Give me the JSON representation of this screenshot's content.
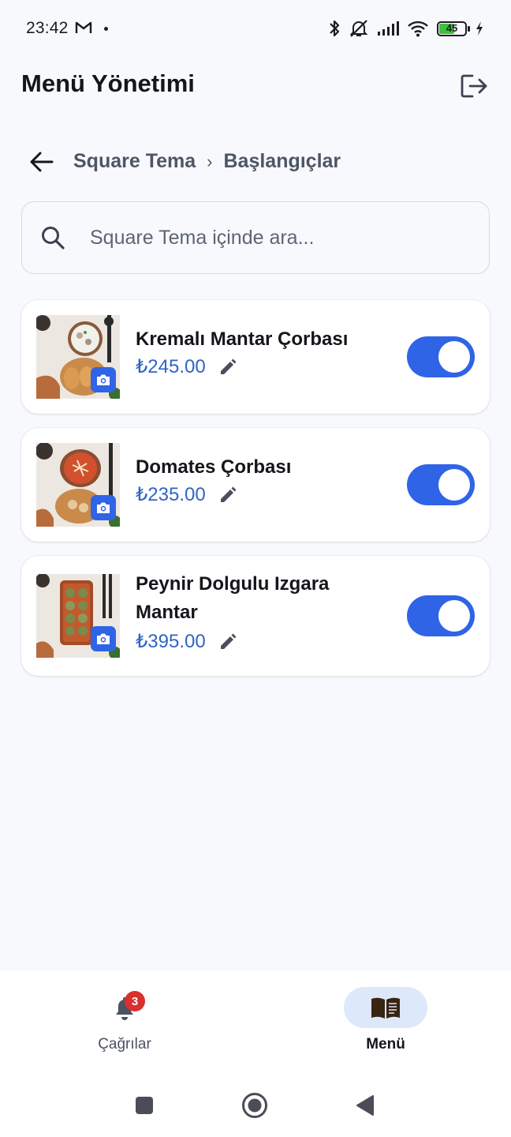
{
  "status_bar": {
    "time": "23:42",
    "battery_level": "45",
    "icons": [
      "gmail-icon",
      "bluetooth-icon",
      "mute-icon",
      "signal-icon",
      "wifi-icon",
      "battery-icon",
      "charging-icon"
    ]
  },
  "header": {
    "title": "Menü Yönetimi",
    "logout_icon": "logout-icon"
  },
  "breadcrumb": {
    "parent": "Square Tema",
    "separator": "›",
    "current": "Başlangıçlar"
  },
  "search": {
    "placeholder": "Square Tema içinde ara...",
    "value": ""
  },
  "items": [
    {
      "name": "Kremalı Mantar Çorbası",
      "price": "₺245.00",
      "active": true,
      "image": "mushroom-soup-photo"
    },
    {
      "name": "Domates Çorbası",
      "price": "₺235.00",
      "active": true,
      "image": "tomato-soup-photo"
    },
    {
      "name_line1": "Peynir Dolgulu Izgara",
      "name_line2": "Mantar",
      "price": "₺395.00",
      "active": true,
      "image": "stuffed-mushroom-photo"
    }
  ],
  "bottom_nav": {
    "calls_label": "Çağrılar",
    "calls_badge": "3",
    "menu_label": "Menü",
    "selected": "Menü"
  },
  "colors": {
    "accent": "#2f64e6",
    "price": "#2f64c6",
    "background": "#f7f9fc",
    "badge": "#d9302c",
    "nav_pill": "#dde8fb"
  }
}
